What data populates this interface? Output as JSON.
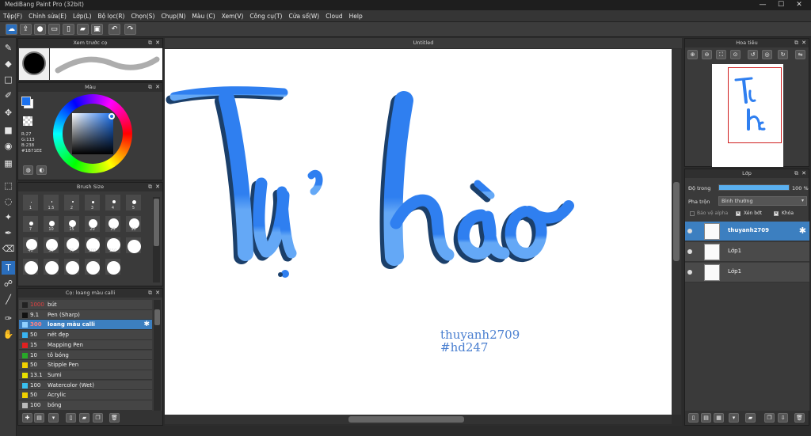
{
  "app": {
    "title": "MediBang Paint Pro (32bit)"
  },
  "menu": [
    "Tệp(F)",
    "Chỉnh sửa(E)",
    "Lớp(L)",
    "Bộ lọc(R)",
    "Chọn(S)",
    "Chụp(N)",
    "Màu (C)",
    "Xem(V)",
    "Công cụ(T)",
    "Cửa sổ(W)",
    "Cloud",
    "Help"
  ],
  "window_controls": {
    "minimize": "—",
    "maximize": "☐",
    "close": "✕"
  },
  "panels": {
    "brush_preview": {
      "title": "Xem trước cọ"
    },
    "color": {
      "title": "Màu",
      "r": "R:27",
      "g": "G:113",
      "b": "B:238",
      "hex": "#1B71EE",
      "fg_color": "#1b71ee",
      "bg_color": "#ffffff"
    },
    "brush_size": {
      "title": "Brush Size",
      "sizes": [
        "1",
        "1.5",
        "2",
        "3",
        "4",
        "5",
        "7",
        "10",
        "15",
        "20",
        "25",
        "30",
        "40",
        "50",
        "70",
        "100",
        "150",
        "",
        "",
        "",
        "",
        "",
        ""
      ]
    },
    "brush_list": {
      "title": "Cọ: loang màu calli",
      "items": [
        {
          "size": "1000",
          "name": "bút",
          "color": "#222222",
          "size_color": "#e04040"
        },
        {
          "size": "9.1",
          "name": "Pen (Sharp)",
          "color": "#111111"
        },
        {
          "size": "300",
          "name": "loang màu calli",
          "color": "#8fd0ff",
          "selected": true,
          "size_color": "#ff8080"
        },
        {
          "size": "50",
          "name": "nét đẹp",
          "color": "#39b4f0"
        },
        {
          "size": "15",
          "name": "Mapping Pen",
          "color": "#e02020"
        },
        {
          "size": "10",
          "name": "tô bóng",
          "color": "#28a828"
        },
        {
          "size": "50",
          "name": "Stipple Pen",
          "color": "#f0d000"
        },
        {
          "size": "13.1",
          "name": "Sumi",
          "color": "#e8e000"
        },
        {
          "size": "100",
          "name": "Watercolor (Wet)",
          "color": "#39c0f0"
        },
        {
          "size": "50",
          "name": "Acrylic",
          "color": "#f0d000"
        },
        {
          "size": "100",
          "name": "bóng",
          "color": "#bbbbbb"
        }
      ]
    },
    "navigator": {
      "title": "Hoa tiêu"
    },
    "layers": {
      "title": "Lớp",
      "opacity_label": "Độ trong",
      "opacity_value": "100 %",
      "opacity_fraction": 1.0,
      "blend_label": "Pha trộn",
      "blend_value": "Bình thường",
      "protect_alpha": "Bảo vệ alpha",
      "clipping": "Xén bớt",
      "lock": "Khóa",
      "items": [
        {
          "name": "thuyanh2709",
          "selected": true
        },
        {
          "name": "Lớp1"
        },
        {
          "name": "Lớp1"
        }
      ]
    }
  },
  "document": {
    "tab": "Untitled",
    "artwork_text": "Tự hào",
    "signature_line1": "thuyanh2709",
    "signature_line2": "#hd247"
  },
  "colors": {
    "accent": "#3c7fc0",
    "ink_light": "#5aa1f5",
    "ink_main": "#2f7ff0",
    "ink_shadow": "#1b3f6a"
  }
}
